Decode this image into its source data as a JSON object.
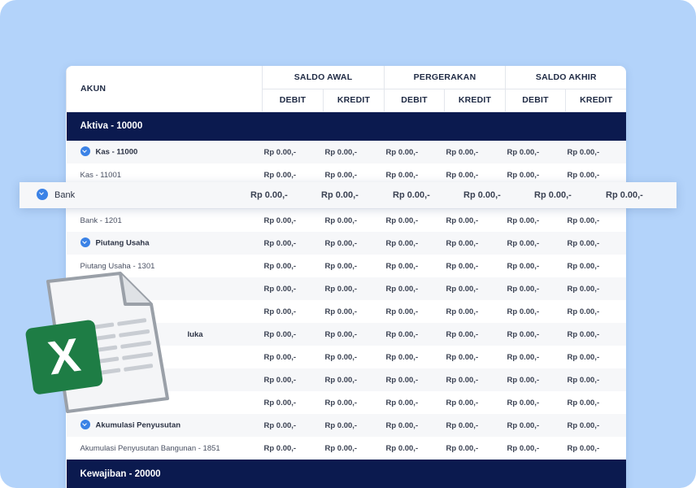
{
  "header": {
    "akun": "AKUN",
    "groups": [
      "SALDO AWAL",
      "PERGERAKAN",
      "SALDO AKHIR"
    ],
    "sub": [
      "DEBIT",
      "KREDIT",
      "DEBIT",
      "KREDIT",
      "DEBIT",
      "KREDIT"
    ]
  },
  "sections": {
    "aktiva": "Aktiva - 10000",
    "kewajiban": "Kewajiban - 20000"
  },
  "rows": [
    {
      "name": "Kas - 11000",
      "vals": [
        "Rp 0.00,-",
        "Rp 0.00,-",
        "Rp 0.00,-",
        "Rp 0.00,-",
        "Rp 0.00,-",
        "Rp 0.00,-"
      ]
    },
    {
      "name": "Kas - 11001",
      "vals": [
        "Rp 0.00,-",
        "Rp 0.00,-",
        "Rp 0.00,-",
        "Rp 0.00,-",
        "Rp 0.00,-",
        "Rp 0.00,-"
      ]
    },
    {
      "name": "",
      "vals": [
        "",
        "",
        "",
        "",
        "",
        ""
      ]
    },
    {
      "name": "Bank - 1201",
      "vals": [
        "Rp 0.00,-",
        "Rp 0.00,-",
        "Rp 0.00,-",
        "Rp 0.00,-",
        "Rp 0.00,-",
        "Rp 0.00,-"
      ]
    },
    {
      "name": "Piutang Usaha",
      "vals": [
        "Rp 0.00,-",
        "Rp 0.00,-",
        "Rp 0.00,-",
        "Rp 0.00,-",
        "Rp 0.00,-",
        "Rp 0.00,-"
      ]
    },
    {
      "name": "Piutang Usaha - 1301",
      "vals": [
        "Rp 0.00,-",
        "Rp 0.00,-",
        "Rp 0.00,-",
        "Rp 0.00,-",
        "Rp 0.00,-",
        "Rp 0.00,-"
      ]
    },
    {
      "name": "",
      "vals": [
        "Rp 0.00,-",
        "Rp 0.00,-",
        "Rp 0.00,-",
        "Rp 0.00,-",
        "Rp 0.00,-",
        "Rp 0.00,-"
      ]
    },
    {
      "name": "",
      "vals": [
        "Rp 0.00,-",
        "Rp 0.00,-",
        "Rp 0.00,-",
        "Rp 0.00,-",
        "Rp 0.00,-",
        "Rp 0.00,-"
      ]
    },
    {
      "name": "luka",
      "vals": [
        "Rp 0.00,-",
        "Rp 0.00,-",
        "Rp 0.00,-",
        "Rp 0.00,-",
        "Rp 0.00,-",
        "Rp 0.00,-"
      ]
    },
    {
      "name": "",
      "vals": [
        "Rp 0.00,-",
        "Rp 0.00,-",
        "Rp 0.00,-",
        "Rp 0.00,-",
        "Rp 0.00,-",
        "Rp 0.00,-"
      ]
    },
    {
      "name": "",
      "vals": [
        "Rp 0.00,-",
        "Rp 0.00,-",
        "Rp 0.00,-",
        "Rp 0.00,-",
        "Rp 0.00,-",
        "Rp 0.00,-"
      ]
    },
    {
      "name": "",
      "vals": [
        "Rp 0.00,-",
        "Rp 0.00,-",
        "Rp 0.00,-",
        "Rp 0.00,-",
        "Rp 0.00,-",
        "Rp 0.00,-"
      ]
    },
    {
      "name": "Akumulasi Penyusutan",
      "vals": [
        "Rp 0.00,-",
        "Rp 0.00,-",
        "Rp 0.00,-",
        "Rp 0.00,-",
        "Rp 0.00,-",
        "Rp 0.00,-"
      ]
    },
    {
      "name": "Akumulasi Penyusutan Bangunan - 1851",
      "vals": [
        "Rp 0.00,-",
        "Rp 0.00,-",
        "Rp 0.00,-",
        "Rp 0.00,-",
        "Rp 0.00,-",
        "Rp 0.00,-"
      ]
    }
  ],
  "floating_row": {
    "name": "Bank",
    "vals": [
      "Rp 0.00,-",
      "Rp 0.00,-",
      "Rp 0.00,-",
      "Rp 0.00,-",
      "Rp 0.00,-",
      "Rp 0.00,-"
    ]
  },
  "icons": {
    "expand": "chevron-down-icon",
    "spreadsheet": "excel-file-icon"
  },
  "colors": {
    "background": "#b3d3fa",
    "section_bg": "#0b1a4f",
    "accent": "#3b82e6",
    "excel_green": "#1e7d45"
  },
  "excel_letter": "X"
}
